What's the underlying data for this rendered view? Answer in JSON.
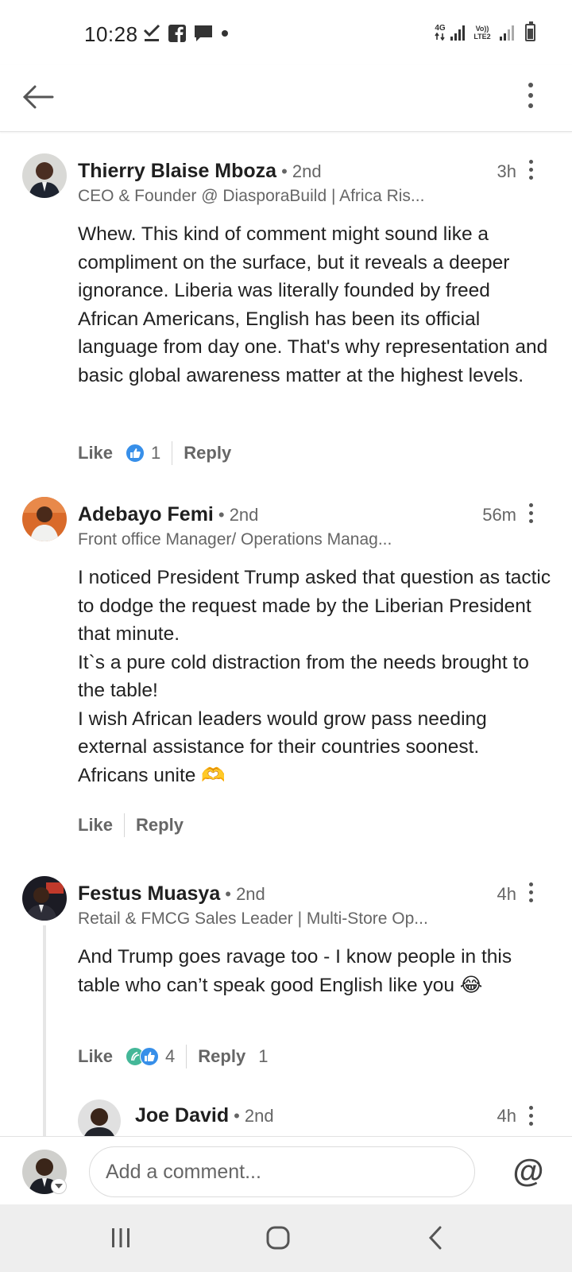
{
  "status_bar": {
    "time": "10:28",
    "left_icons": [
      "check-icon",
      "facebook-icon",
      "chat-icon",
      "dot-icon"
    ],
    "network_label": "4G",
    "volte_label": "Vo)) LTE2"
  },
  "header": {
    "back_icon": "arrow-left-icon",
    "more_icon": "kebab-icon"
  },
  "comments": [
    {
      "author": "Thierry Blaise Mboza",
      "degree": "• 2nd",
      "headline": "CEO & Founder @ DiasporaBuild | Africa Ris...",
      "time": "3h",
      "text": "Whew. This kind of comment might sound like a compliment on the surface, but it reveals a deeper ignorance. Liberia was literally founded by freed African Americans, English has been its official language from day one. That's why representation and basic global awareness matter at the highest levels.",
      "like_label": "Like",
      "reaction_count": "1",
      "reply_label": "Reply"
    },
    {
      "author": "Adebayo Femi",
      "degree": "• 2nd",
      "headline": "Front office Manager/ Operations Manag...",
      "time": "56m",
      "text_lines": [
        "I noticed President Trump asked that question as tactic to dodge the request made by the Liberian President that minute.",
        "It`s a pure cold distraction from the needs brought to the table!",
        "I wish African leaders would grow pass needing external assistance for their countries soonest.",
        "Africans unite 🫶"
      ],
      "like_label": "Like",
      "reply_label": "Reply"
    },
    {
      "author": "Festus Muasya",
      "degree": "• 2nd",
      "headline": "Retail & FMCG Sales Leader | Multi-Store Op...",
      "time": "4h",
      "text": "And Trump goes ravage too - I know people in this table who can’t speak good English like you 😂",
      "like_label": "Like",
      "reaction_count": "4",
      "reply_label": "Reply",
      "reply_count": "1"
    },
    {
      "author": "Joe David",
      "degree": "• 2nd",
      "time": "4h"
    }
  ],
  "composer": {
    "placeholder": "Add a comment...",
    "mention_symbol": "@"
  },
  "colors": {
    "like_blue": "#378fe9",
    "celebrate_green": "#44b798",
    "text_primary": "#191919",
    "text_secondary": "#666666"
  }
}
